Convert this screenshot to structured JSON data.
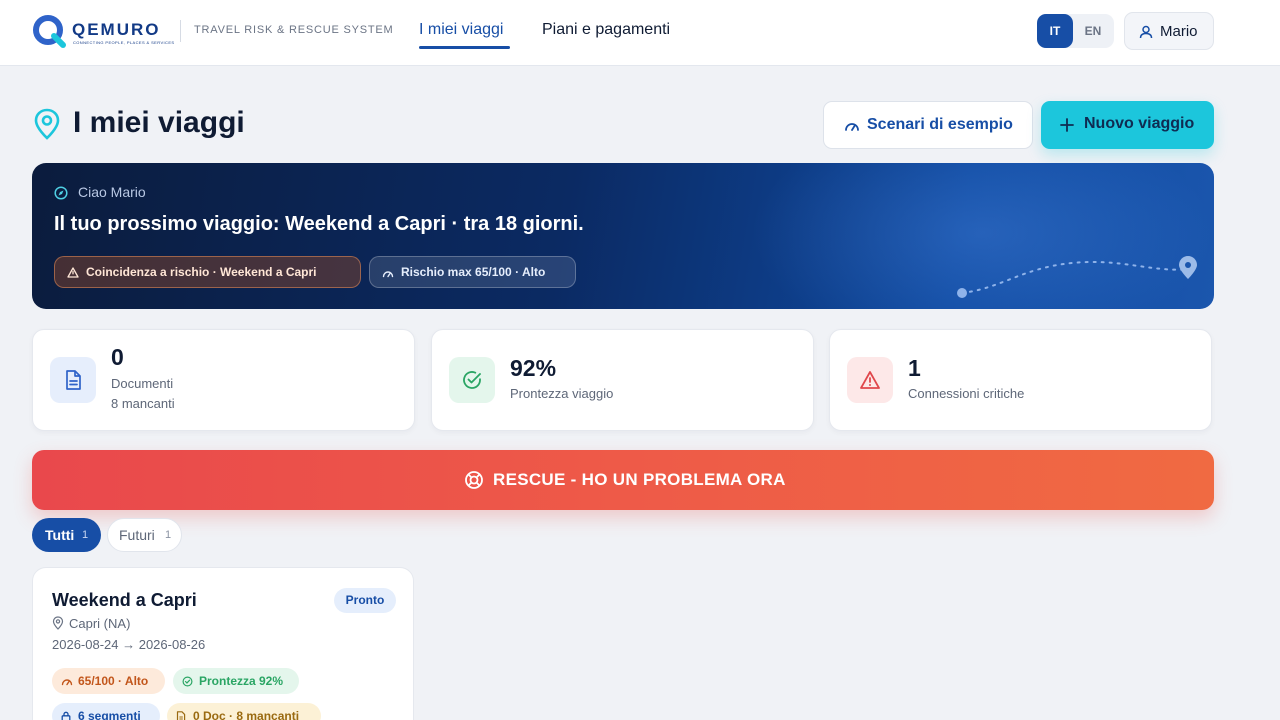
{
  "header": {
    "logo_text": "QEMURO",
    "logo_tagline": "CONNECTING PEOPLE, PLACES & SERVICES",
    "subtitle": "TRAVEL RISK & RESCUE SYSTEM",
    "nav": [
      {
        "label": "I miei viaggi",
        "active": true
      },
      {
        "label": "Piani e pagamenti",
        "active": false
      }
    ],
    "languages": [
      {
        "label": "IT",
        "active": true
      },
      {
        "label": "EN",
        "active": false
      }
    ],
    "user_name": "Mario"
  },
  "page": {
    "title": "I miei viaggi",
    "scenarios_button": "Scenari di esempio",
    "new_trip_button": "Nuovo viaggio"
  },
  "hero": {
    "greeting": "Ciao Mario",
    "headline_prefix": "Il tuo prossimo viaggio: ",
    "headline_trip": "Weekend a Capri",
    "headline_suffix": " · tra 18 giorni.",
    "warning_pill": "Coincidenza a rischio · Weekend a Capri",
    "risk_pill": "Rischio max 65/100 · Alto"
  },
  "stats": [
    {
      "value": "0",
      "label": "Documenti",
      "sublabel": "8 mancanti",
      "icon": "document-icon",
      "color": "#2f63c9",
      "bg": "#e6eefc"
    },
    {
      "value": "92%",
      "label": "Prontezza viaggio",
      "icon": "check-circle-icon",
      "color": "#2aa564",
      "bg": "#e4f6ec"
    },
    {
      "value": "1",
      "label": "Connessioni critiche",
      "icon": "warning-triangle-icon",
      "color": "#e0474c",
      "bg": "#fde8e8"
    }
  ],
  "rescue_button": "RESCUE - HO UN PROBLEMA ORA",
  "filters": [
    {
      "label": "Tutti",
      "count": "1",
      "active": true
    },
    {
      "label": "Futuri",
      "count": "1",
      "active": false
    }
  ],
  "trips": [
    {
      "title": "Weekend a Capri",
      "status": "Pronto",
      "location": "Capri (NA)",
      "dates": "2026-08-24 → 2026-08-26",
      "tags": [
        {
          "label": "65/100 · Alto",
          "icon": "gauge-icon",
          "color": "#c2561b",
          "bg": "#fdeadb"
        },
        {
          "label": "Prontezza 92%",
          "icon": "check-circle-icon",
          "color": "#2aa564",
          "bg": "#e4f6ec"
        },
        {
          "label": "6 segmenti",
          "icon": "lock-icon",
          "color": "#174ea6",
          "bg": "#e5eefc"
        },
        {
          "label": "0 Doc · 8 mancanti",
          "icon": "document-icon",
          "color": "#9a6a10",
          "bg": "#fcf1d6"
        }
      ]
    }
  ],
  "colors": {
    "primary": "#174ea6",
    "accent": "#1cc6dc",
    "rescue": "#ee5a48",
    "background": "#f0f2f6"
  }
}
